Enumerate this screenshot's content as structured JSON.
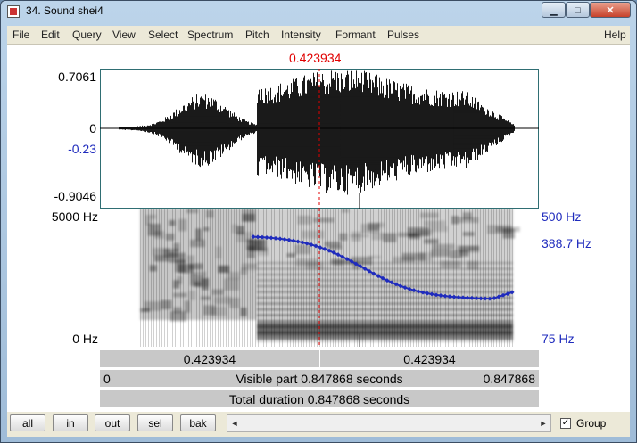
{
  "window": {
    "title": "34. Sound shei4"
  },
  "titlebar_buttons": {
    "minimize": "▁",
    "maximize": "□",
    "close": "✕"
  },
  "menu": [
    "File",
    "Edit",
    "Query",
    "View",
    "Select",
    "Spectrum",
    "Pitch",
    "Intensity",
    "Formant",
    "Pulses",
    "Help"
  ],
  "cursor_time_label": "0.423934",
  "cursor_fraction": 0.5,
  "waveform": {
    "ymax_label": "0.7061",
    "zero_label": "0",
    "cursor_value_label": "-0.23",
    "ymin_label": "-0.9046"
  },
  "spectrogram": {
    "freq_top_label": "5000 Hz",
    "freq_bottom_label": "0 Hz"
  },
  "pitch": {
    "top_label": "500 Hz",
    "value_label": "388.7 Hz",
    "bottom_label": "75 Hz",
    "color": "#1f2bbd"
  },
  "bars": {
    "left_time": "0.423934",
    "right_time": "0.423934",
    "visible_start": "0",
    "visible_label": "Visible part 0.847868 seconds",
    "visible_end": "0.847868",
    "total_label": "Total duration 0.847868 seconds"
  },
  "buttons": [
    "all",
    "in",
    "out",
    "sel",
    "bak"
  ],
  "scroll_arrows": {
    "left": "◄",
    "right": "►"
  },
  "group": {
    "label": "Group",
    "checked": true,
    "mark": "✓"
  }
}
